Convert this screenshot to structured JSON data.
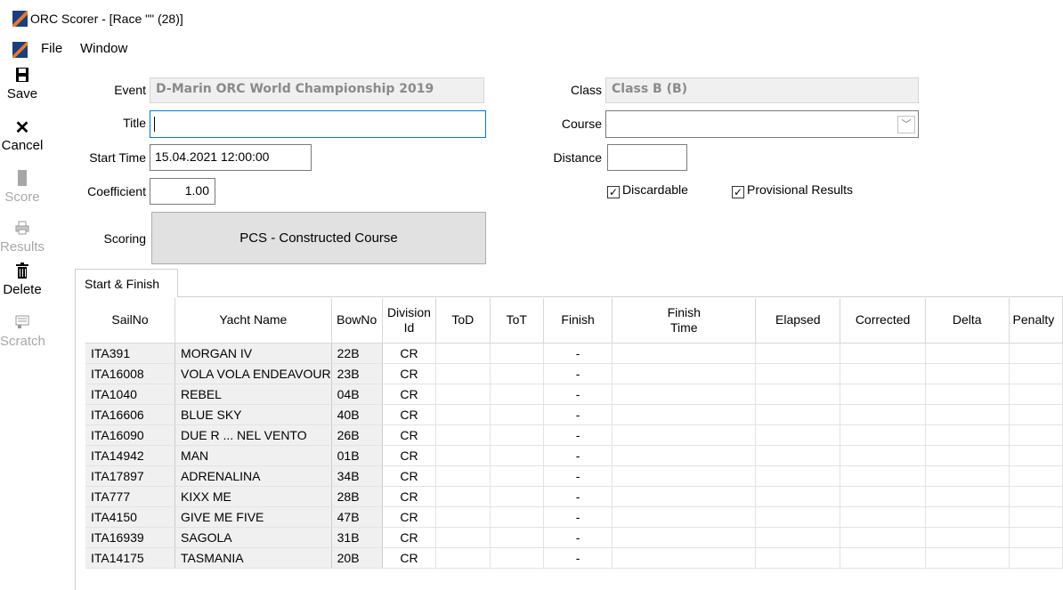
{
  "window": {
    "title": "ORC Scorer - [Race \"\" (28)]"
  },
  "menu": {
    "file": "File",
    "window": "Window"
  },
  "toolbar": {
    "save": "Save",
    "cancel": "Cancel",
    "score": "Score",
    "results": "Results",
    "delete": "Delete",
    "scratch": "Scratch"
  },
  "form": {
    "event_label": "Event",
    "event_value": "D-Marin ORC World Championship 2019",
    "title_label": "Title",
    "title_value": "",
    "start_time_label": "Start Time",
    "start_time_value": "15.04.2021 12:00:00",
    "coefficient_label": "Coefficient",
    "coefficient_value": "1.00",
    "scoring_label": "Scoring",
    "scoring_value": "PCS - Constructed Course",
    "class_label": "Class",
    "class_value": "Class B (B)",
    "course_label": "Course",
    "course_value": "",
    "distance_label": "Distance",
    "distance_value": "",
    "discardable_label": "Discardable",
    "discardable_checked": true,
    "provisional_label": "Provisional Results",
    "provisional_checked": true
  },
  "tabs": {
    "start_finish": "Start & Finish"
  },
  "grid": {
    "columns": [
      "SailNo",
      "Yacht Name",
      "BowNo",
      "Division\nId",
      "ToD",
      "ToT",
      "Finish",
      "Finish\nTime",
      "Elapsed",
      "Corrected",
      "Delta",
      "Penalty"
    ],
    "rows": [
      [
        "ITA391",
        "MORGAN IV",
        "22B",
        "CR",
        "",
        "",
        "-",
        "",
        "",
        "",
        "",
        ""
      ],
      [
        "ITA16008",
        "VOLA VOLA ENDEAVOUR",
        "23B",
        "CR",
        "",
        "",
        "-",
        "",
        "",
        "",
        "",
        ""
      ],
      [
        "ITA1040",
        "REBEL",
        "04B",
        "CR",
        "",
        "",
        "-",
        "",
        "",
        "",
        "",
        ""
      ],
      [
        "ITA16606",
        "BLUE SKY",
        "40B",
        "CR",
        "",
        "",
        "-",
        "",
        "",
        "",
        "",
        ""
      ],
      [
        "ITA16090",
        "DUE R ... NEL VENTO",
        "26B",
        "CR",
        "",
        "",
        "-",
        "",
        "",
        "",
        "",
        ""
      ],
      [
        "ITA14942",
        "MAN",
        "01B",
        "CR",
        "",
        "",
        "-",
        "",
        "",
        "",
        "",
        ""
      ],
      [
        "ITA17897",
        "ADRENALINA",
        "34B",
        "CR",
        "",
        "",
        "-",
        "",
        "",
        "",
        "",
        ""
      ],
      [
        "ITA777",
        "KIXX ME",
        "28B",
        "CR",
        "",
        "",
        "-",
        "",
        "",
        "",
        "",
        ""
      ],
      [
        "ITA4150",
        "GIVE ME FIVE",
        "47B",
        "CR",
        "",
        "",
        "-",
        "",
        "",
        "",
        "",
        ""
      ],
      [
        "ITA16939",
        "SAGOLA",
        "31B",
        "CR",
        "",
        "",
        "-",
        "",
        "",
        "",
        "",
        ""
      ],
      [
        "ITA14175",
        "TASMANIA",
        "20B",
        "CR",
        "",
        "",
        "-",
        "",
        "",
        "",
        "",
        ""
      ]
    ]
  }
}
